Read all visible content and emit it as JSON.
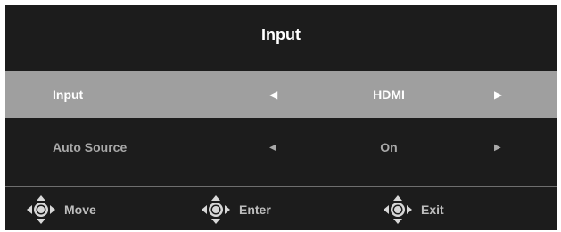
{
  "window": {
    "title": "Input"
  },
  "menu": {
    "rows": [
      {
        "label": "Input",
        "value": "HDMI",
        "selected": true
      },
      {
        "label": "Auto Source",
        "value": "On",
        "selected": false
      }
    ]
  },
  "footer": {
    "items": [
      {
        "label": "Move",
        "icon": "dpad-move-icon"
      },
      {
        "label": "Enter",
        "icon": "dpad-enter-icon"
      },
      {
        "label": "Exit",
        "icon": "dpad-exit-icon"
      }
    ]
  },
  "colors": {
    "background": "#1c1c1c",
    "selected_row": "#9f9f9f",
    "text_primary": "#ffffff",
    "text_secondary": "#a9a9a9"
  }
}
